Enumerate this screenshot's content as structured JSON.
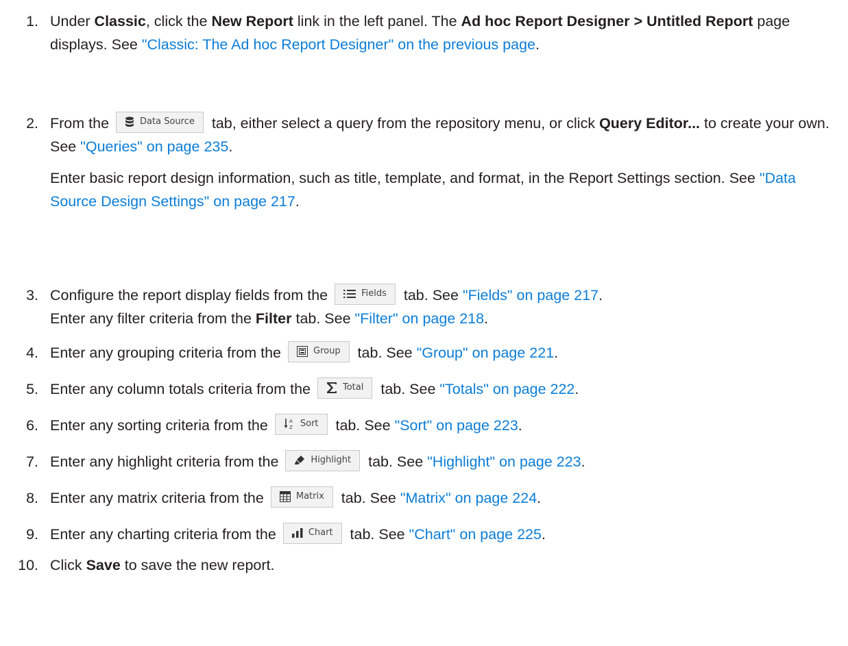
{
  "steps": [
    {
      "num": "1.",
      "t1": "Under ",
      "b1": "Classic",
      "t2": ", click the ",
      "b2": "New Report",
      "t3": " link in the left panel. The ",
      "b3": "Ad hoc Report Designer > Untitled Report",
      "t4": " page displays. See ",
      "link": "\"Classic: The Ad hoc Report Designer\" on the previous page",
      "t5": "."
    },
    {
      "num": "2.",
      "pre": "From the",
      "tab": "Data Source",
      "post1": " tab, either select a query from the repository menu, or click ",
      "bold": "Query Editor...",
      "post2": " to create your own. See ",
      "link": "\"Queries\" on page 235",
      "end": ".",
      "p2_text": "Enter basic report design information, such as title, template, and format, in the Report Settings section. See ",
      "p2_link": "\"Data Source Design Settings\" on page 217",
      "p2_end": "."
    },
    {
      "num": "3.",
      "pre": "Configure the report display fields from the",
      "tab": "Fields",
      "post": " tab. See ",
      "link": "\"Fields\" on page 217",
      "end": ".",
      "l2_pre": "Enter any filter criteria from the ",
      "l2_bold": "Filter",
      "l2_post": " tab. See ",
      "l2_link": "\"Filter\" on page 218",
      "l2_end": "."
    },
    {
      "num": "4.",
      "pre": "Enter any grouping criteria from the",
      "tab": "Group",
      "post": " tab. See ",
      "link": "\"Group\" on page 221",
      "end": "."
    },
    {
      "num": "5.",
      "pre": "Enter any column totals criteria from the",
      "tab": "Total",
      "post": " tab. See ",
      "link": "\"Totals\" on page 222",
      "end": "."
    },
    {
      "num": "6.",
      "pre": "Enter any sorting criteria from the",
      "tab": "Sort",
      "post": " tab. See ",
      "link": "\"Sort\" on page 223",
      "end": "."
    },
    {
      "num": "7.",
      "pre": "Enter any highlight criteria from the",
      "tab": "Highlight",
      "post": " tab. See ",
      "link": "\"Highlight\" on page 223",
      "end": "."
    },
    {
      "num": "8.",
      "pre": "Enter any matrix criteria from the",
      "tab": "Matrix",
      "post": " tab. See ",
      "link": "\"Matrix\" on page 224",
      "end": "."
    },
    {
      "num": "9.",
      "pre": "Enter any charting criteria from the",
      "tab": "Chart",
      "post": " tab. See ",
      "link": "\"Chart\" on page 225",
      "end": "."
    },
    {
      "num": "10.",
      "pre": "Click ",
      "bold": "Save",
      "post": " to save the new report."
    }
  ],
  "colors": {
    "text": "#231f20",
    "link": "#0b7dd7",
    "tab_bg": "#f2f2f2",
    "tab_border": "#c9c9c9"
  }
}
